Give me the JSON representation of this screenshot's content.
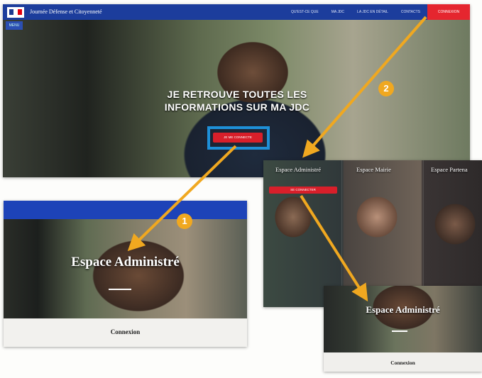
{
  "main_site": {
    "site_title": "Journée Défense et Citoyenneté",
    "menu_label": "MENU",
    "nav": [
      "QU'EST-CE QUE",
      "MA JDC",
      "LA JDC EN DÉTAIL",
      "CONTACTS"
    ],
    "connect_label": "CONNEXION",
    "hero_line1": "JE RETROUVE TOUTES LES",
    "hero_line2": "INFORMATIONS SUR MA JDC",
    "cta_label": "JE ME CONNECTE"
  },
  "admin_page": {
    "title": "Espace Administré",
    "login_label": "Connexion"
  },
  "espaces_page": {
    "espace_administre": "Espace Administré",
    "espace_mairie": "Espace Mairie",
    "espace_partenaire": "Espace Partena",
    "connect_label": "SE CONNECTER"
  },
  "admin_page_small": {
    "title": "Espace Administré",
    "login_label": "Connexion"
  },
  "annotations": {
    "step1": "1",
    "step2": "2"
  },
  "colors": {
    "brand_blue": "#1c3d9c",
    "cta_red": "#d81f2a",
    "highlight_blue": "#1e90d8",
    "annotation_orange": "#f0a820"
  }
}
